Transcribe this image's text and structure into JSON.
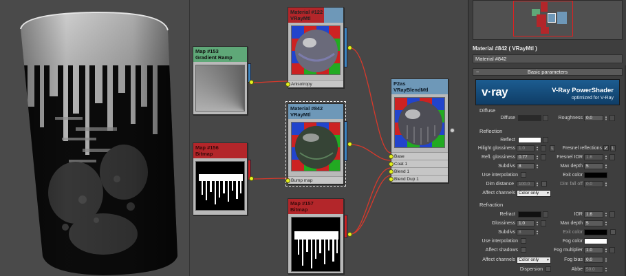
{
  "nodes": {
    "gradient_ramp": {
      "title": "Map #153",
      "type": "Gradient Ramp"
    },
    "vraymtl_122": {
      "title": "Material #122",
      "type": "VRayMtl",
      "slot": "Anisotropy"
    },
    "vraymtl_842": {
      "title": "Material #842",
      "type": "VRayMtl",
      "slot": "Bump map"
    },
    "bitmap_156": {
      "title": "Map #156",
      "type": "Bitmap"
    },
    "bitmap_157": {
      "title": "Map #157",
      "type": "Bitmap"
    },
    "blend": {
      "title": "P2as",
      "type": "VRayBlendMtl",
      "slots": [
        "Base",
        "Coat 1",
        "Blend 1",
        "Blend Dup 1"
      ]
    }
  },
  "panel": {
    "title": "Material #842  ( VRayMtl )",
    "name_value": "Material #842",
    "rollout": "Basic parameters",
    "banner": {
      "logo": "v·ray",
      "title": "V-Ray PowerShader",
      "subtitle": "optimized for V-Ray"
    },
    "diffuse": {
      "group": "Diffuse",
      "diffuse_label": "Diffuse",
      "roughness_label": "Roughness",
      "roughness_value": "0.0"
    },
    "reflection": {
      "group": "Reflection",
      "reflect_label": "Reflect",
      "hilight_label": "Hilight glossiness",
      "hilight_value": "1.0",
      "l_btn": "L",
      "fresnel_label": "Fresnel reflections",
      "fresnel_check": "✓",
      "refl_gloss_label": "Refl. glossiness",
      "refl_gloss_value": "0.77",
      "fresnel_ior_label": "Fresnel IOR",
      "fresnel_ior_value": "1.6",
      "subdivs_label": "Subdivs",
      "subdivs_value": "8",
      "max_depth_label": "Max depth",
      "max_depth_value": "5",
      "use_interp_label": "Use interpolation",
      "exit_color_label": "Exit color",
      "dim_distance_label": "Dim distance",
      "dim_distance_value": "100.0",
      "dim_falloff_label": "Dim fall off",
      "dim_falloff_value": "0.0",
      "affect_channels_label": "Affect channels",
      "affect_channels_value": "Color only"
    },
    "refraction": {
      "group": "Refraction",
      "refract_label": "Refract",
      "ior_label": "IOR",
      "ior_value": "1.6",
      "glossiness_label": "Glossiness",
      "glossiness_value": "1.0",
      "max_depth_label": "Max depth",
      "max_depth_value": "5",
      "subdivs_label": "Subdivs",
      "subdivs_value": "8",
      "exit_color_label": "Exit color",
      "use_interp_label": "Use interpolation",
      "fog_color_label": "Fog color",
      "affect_shadows_label": "Affect shadows",
      "fog_mult_label": "Fog multiplier",
      "fog_mult_value": "1.0",
      "affect_channels_label": "Affect channels",
      "affect_channels_value": "Color only",
      "fog_bias_label": "Fog bias",
      "fog_bias_value": "0.0",
      "dispersion_label": "Dispersion",
      "abbe_label": "Abbe",
      "abbe_value": "50.0"
    },
    "colors": {
      "reflect": "#ffffff",
      "diffuse": "#2a2a2a",
      "exit": "#000000",
      "fog": "#ffffff",
      "refract": "#101010",
      "accent_blue": "#1c5c90",
      "socket": "#e5f21e",
      "wire": "#d8392b"
    }
  }
}
